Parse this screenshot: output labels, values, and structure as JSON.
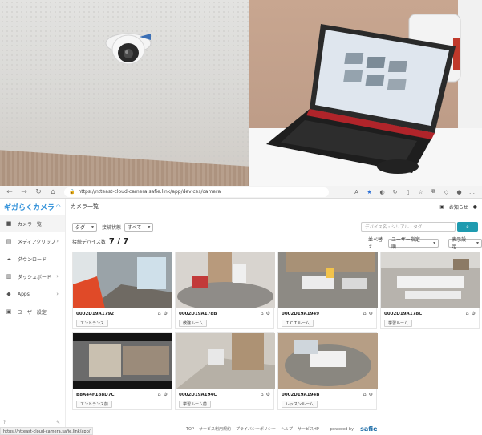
{
  "browser": {
    "url": "https://ntteast-cloud-camera.safie.link/app/devices/camera"
  },
  "sidebar": {
    "logo": "ギガらくカメラ",
    "items": [
      {
        "label": "カメラ一覧",
        "icon": "camera-icon",
        "active": true
      },
      {
        "label": "メディアクリップ",
        "icon": "media-clip-icon",
        "chevron": true
      },
      {
        "label": "ダウンロード",
        "icon": "cloud-download-icon"
      },
      {
        "label": "ダッシュボード",
        "icon": "dashboard-icon",
        "chevron": true
      },
      {
        "label": "Apps",
        "icon": "apps-icon",
        "chevron": true
      },
      {
        "label": "ユーザー設定",
        "icon": "user-icon"
      }
    ],
    "status_url": "https://ntteast-cloud-camera.safie.link/app/"
  },
  "header": {
    "title": "カメラ一覧",
    "notice": "お知らせ"
  },
  "filters": {
    "tag": "タグ",
    "connection_label": "接続状態",
    "connection_value": "すべて",
    "search_placeholder": "デバイス名・シリアル・タグ"
  },
  "count": {
    "label": "接続デバイス数",
    "value": "7 / 7"
  },
  "sort": {
    "label": "並べ替え",
    "value": "ユーザー指定順",
    "display": "表示設定"
  },
  "cameras": [
    {
      "id": "0002D19A1792",
      "tag": "エントランス"
    },
    {
      "id": "0002D19A178B",
      "tag": "教務ルーム"
    },
    {
      "id": "0002D19A1949",
      "tag": "ＩＣＴルーム"
    },
    {
      "id": "0002D19A178C",
      "tag": "学習ルーム"
    },
    {
      "id": "B8A44F188D7C",
      "tag": "エントランス前"
    },
    {
      "id": "0002D19A194C",
      "tag": "学習ルーム前"
    },
    {
      "id": "0002D19A194B",
      "tag": "レッスンルーム"
    }
  ],
  "footer": {
    "links": [
      "TOP",
      "サービス利用規約",
      "プライバシーポリシー",
      "ヘルプ",
      "サービスHP"
    ],
    "powered_by": "powered by",
    "brand": "safie"
  }
}
